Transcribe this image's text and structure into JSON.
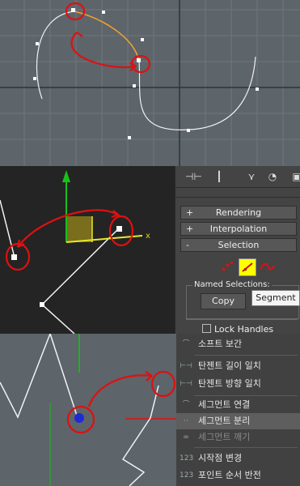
{
  "viewport_top": {
    "background": "#5d646a"
  },
  "viewport_mid": {
    "axis_label_x": "x"
  },
  "command_panel": {
    "rollouts": [
      {
        "sign": "+",
        "label": "Rendering"
      },
      {
        "sign": "+",
        "label": "Interpolation"
      },
      {
        "sign": "-",
        "label": "Selection"
      }
    ],
    "named_selections_label": "Named Selections:",
    "copy_label": "Copy",
    "tooltip_label": "Segment",
    "lock_handles_label": "Lock Handles"
  },
  "quad_menu": {
    "items": [
      {
        "icon": "soft-icon",
        "label": "소프트 보간",
        "state": "normal"
      },
      {
        "icon": "tangent-length-icon",
        "label": "탄젠트 길이 일치",
        "state": "normal"
      },
      {
        "icon": "tangent-direction-icon",
        "label": "탄젠트 방향 일치",
        "state": "normal"
      },
      {
        "icon": "segment-connect-icon",
        "label": "세그먼트 연결",
        "state": "normal"
      },
      {
        "icon": "segment-detach-icon",
        "label": "세그먼트 분리",
        "state": "selected"
      },
      {
        "icon": "segment-break-icon",
        "label": "세그먼트 깨기",
        "state": "disabled"
      },
      {
        "icon": "first-vertex-icon",
        "label": "시작점 변경",
        "state": "normal"
      },
      {
        "icon": "reverse-order-icon",
        "label": "포인트 순서 반전",
        "state": "normal"
      }
    ]
  },
  "colors": {
    "accent_orange": "#f0a030",
    "annotation_red": "#e01010",
    "highlight_yellow": "#ffff00"
  }
}
